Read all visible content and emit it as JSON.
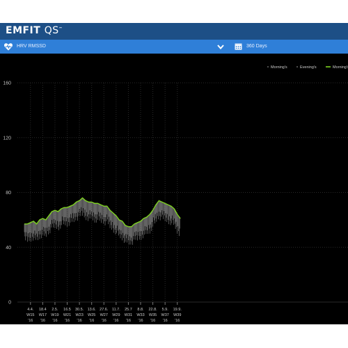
{
  "app": {
    "logo_main": "EMFIT",
    "logo_sub": "QS",
    "logo_tm": "™"
  },
  "toolbar": {
    "metric_icon": "heart-pulse-icon",
    "metric_label": "HRV RMSSD",
    "dropdown_icon": "chevron-down-icon",
    "range_icon": "calendar-icon",
    "range_label": "360 Days"
  },
  "colors": {
    "header": "#1d4f86",
    "toolbar": "#2f7fd8",
    "chart_bg": "#000000",
    "line": "#7ed321",
    "bars": "#8c8c8c",
    "grid": "#2a2a2a"
  },
  "chart_data": {
    "type": "line",
    "legend": [
      "Morning's",
      "Evening's",
      "Morning's"
    ],
    "legend_placement": "top-right",
    "ylim": [
      0,
      160
    ],
    "yticks": [
      "0",
      "40",
      "80",
      "120",
      "160"
    ],
    "xlim": [
      0,
      52.9
    ],
    "xticks": [
      {
        "pos": 1,
        "lines": [
          "4.4.",
          "W15",
          "'16"
        ]
      },
      {
        "pos": 3,
        "lines": [
          "18.4",
          "W17",
          "'16"
        ]
      },
      {
        "pos": 5,
        "lines": [
          "2.5.",
          "W19",
          "'16"
        ]
      },
      {
        "pos": 7,
        "lines": [
          "16.5",
          "W21",
          "'16"
        ]
      },
      {
        "pos": 9,
        "lines": [
          "30.5.",
          "W23",
          "'16"
        ]
      },
      {
        "pos": 11,
        "lines": [
          "13.6.",
          "W25",
          "'16"
        ]
      },
      {
        "pos": 13,
        "lines": [
          "27.6.",
          "W27",
          "'16"
        ]
      },
      {
        "pos": 15,
        "lines": [
          "11.7.",
          "W29",
          "'16"
        ]
      },
      {
        "pos": 17,
        "lines": [
          "25.7",
          "W31",
          "'16"
        ]
      },
      {
        "pos": 19,
        "lines": [
          "8.8.",
          "W33",
          "'16"
        ]
      },
      {
        "pos": 21,
        "lines": [
          "22.8.",
          "W35",
          "'16"
        ]
      },
      {
        "pos": 23,
        "lines": [
          "5.9.",
          "W37",
          "'16"
        ]
      },
      {
        "pos": 25,
        "lines": [
          "19.9.",
          "W39",
          "'16"
        ]
      }
    ],
    "series": [
      {
        "name": "Morning's",
        "x": [
          0,
          0.5,
          1,
          1.5,
          2,
          2.5,
          3,
          3.5,
          4,
          4.5,
          5,
          5.5,
          6,
          6.5,
          7,
          7.5,
          8,
          8.5,
          9,
          9.5,
          10,
          10.5,
          11,
          11.5,
          12,
          12.5,
          13,
          13.5,
          14,
          14.5,
          15,
          15.5,
          16,
          16.5,
          17,
          17.5,
          18,
          18.5,
          19,
          19.5,
          20,
          20.5,
          21,
          21.5,
          22,
          22.5,
          23,
          23.5,
          24,
          24.5,
          25,
          25.5
        ],
        "y": [
          57,
          57,
          58,
          59,
          57,
          60,
          61,
          60,
          63,
          66,
          67,
          66,
          68,
          69,
          69,
          70,
          71,
          73,
          74,
          76,
          74,
          73,
          73,
          72,
          72,
          71,
          70,
          70,
          67,
          65,
          63,
          60,
          59,
          56,
          55,
          55,
          57,
          58,
          59,
          61,
          62,
          64,
          67,
          71,
          74,
          73,
          72,
          71,
          70,
          68,
          64,
          61
        ]
      }
    ]
  }
}
